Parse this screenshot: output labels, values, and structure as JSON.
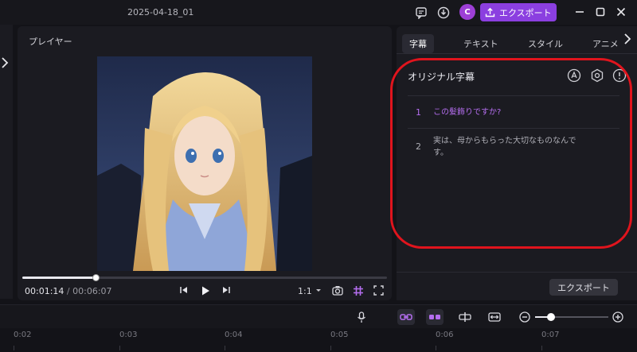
{
  "window": {
    "title": "2025-04-18_01",
    "export_label": "エクスポート",
    "avatar_letter": "C"
  },
  "player": {
    "header": "プレイヤー",
    "current_time": "00:01:14",
    "separator": "/",
    "total_time": "00:06:07",
    "ratio": "1:1",
    "progress": 0.2
  },
  "panel": {
    "tabs": [
      {
        "label": "字幕",
        "active": true
      },
      {
        "label": "テキスト",
        "active": false
      },
      {
        "label": "スタイル",
        "active": false
      },
      {
        "label": "アニメ",
        "active": false
      }
    ],
    "title": "オリジナル字幕",
    "subtitles": [
      {
        "num": "1",
        "text": "この髪飾りですか?",
        "active": true
      },
      {
        "num": "2",
        "text": "実は、母からもらった大切なものなんです。",
        "active": false
      }
    ],
    "export_label": "エクスポート"
  },
  "timeline": {
    "ticks": [
      "0:02",
      "0:03",
      "0:04",
      "0:05",
      "0:06",
      "0:07"
    ],
    "zoom": 0.22
  },
  "colors": {
    "accent": "#8b3fe0",
    "highlight": "#e0141d",
    "active_subtitle": "#b56ef0"
  }
}
